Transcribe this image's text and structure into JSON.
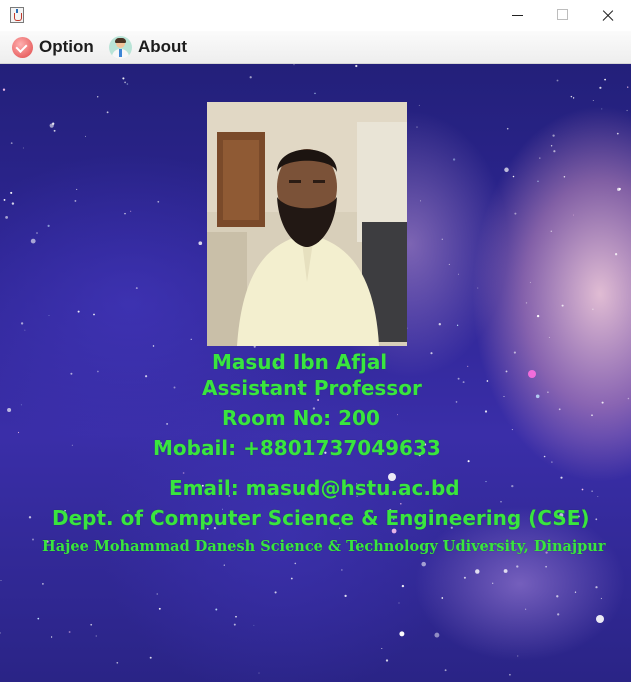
{
  "window": {
    "app_icon": "java-cup-icon",
    "controls": [
      "minimize-icon",
      "maximize-icon",
      "close-icon"
    ]
  },
  "menubar": {
    "items": [
      {
        "label": "Option",
        "icon": "checkmark-icon"
      },
      {
        "label": "About",
        "icon": "person-icon"
      }
    ]
  },
  "profile": {
    "name": "Masud Ibn Afjal",
    "designation": "Assistant Professor",
    "room": "Room No: 200",
    "mobile": "Mobail: +8801737049633",
    "email": "Email: masud@hstu.ac.bd",
    "department": "Dept. of Computer Science & Engineering (CSE)",
    "university": "Hajee Mohammad Danesh Science & Technology Udiversity, Dinajpur"
  },
  "colors": {
    "text": "#39e53f",
    "background": "#2d2592",
    "nebula": "#f5c6cf"
  }
}
